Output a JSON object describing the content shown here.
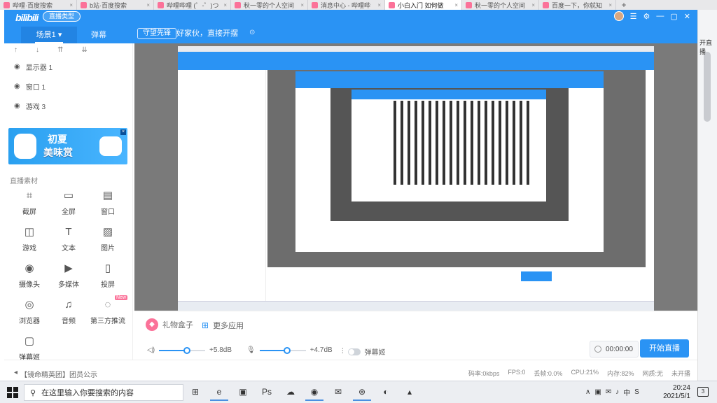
{
  "browser": {
    "tabs": [
      {
        "label": "哔哩·百度搜索",
        "active": false
      },
      {
        "label": "b站·百度搜索",
        "active": false
      },
      {
        "label": "哔哩哔哩 (゜-゜)つ",
        "active": false
      },
      {
        "label": "秋一零的个人空间",
        "active": false
      },
      {
        "label": "消息中心 - 哔哩哔",
        "active": false
      },
      {
        "label": "小白入门 如何做",
        "active": true
      },
      {
        "label": "秋一零的个人空间",
        "active": false
      },
      {
        "label": "百度一下，你就知",
        "active": false
      }
    ],
    "new_tab": "+",
    "page_edge_text": "开直播"
  },
  "header": {
    "logo": "bilibili",
    "room_type": "直播类型",
    "scene_tab": "场景1",
    "danmu_tab": "弹幕",
    "guard_button": "守望先锋",
    "hint": "好家伙，直接开摆",
    "hint_icon": "⊙",
    "icons": [
      "☰",
      "⚙",
      "—",
      "▢",
      "✕"
    ]
  },
  "sources": {
    "order_icons": [
      "↑",
      "↓",
      "⇈",
      "⇊"
    ],
    "items": [
      {
        "label": "显示器 1"
      },
      {
        "label": "窗口 1"
      },
      {
        "label": "游戏 3"
      }
    ]
  },
  "banner": {
    "line1": "初夏",
    "line2": "美味赏",
    "close": "×"
  },
  "materials": {
    "title": "直播素材",
    "items": [
      {
        "label": "截屏",
        "icon": "⌗"
      },
      {
        "label": "全屏",
        "icon": "▭"
      },
      {
        "label": "窗口",
        "icon": "▤"
      },
      {
        "label": "游戏",
        "icon": "◫"
      },
      {
        "label": "文本",
        "icon": "T"
      },
      {
        "label": "图片",
        "icon": "▨"
      },
      {
        "label": "摄像头",
        "icon": "◉"
      },
      {
        "label": "多媒体",
        "icon": "▶"
      },
      {
        "label": "投屏",
        "icon": "▯"
      },
      {
        "label": "浏览器",
        "icon": "◎"
      },
      {
        "label": "音频",
        "icon": "♫"
      },
      {
        "label": "第三方推流",
        "icon": "◌",
        "badge": "New"
      },
      {
        "label": "弹幕姬",
        "icon": "▢"
      }
    ]
  },
  "controls": {
    "gift_label": "礼物盒子",
    "more_apps_label": "更多应用",
    "speaker_volume": "+5.8dB",
    "speaker_level": 0.6,
    "mic_volume": "+4.7dB",
    "mic_level": 0.6,
    "danmu_toggle": "弹幕姬",
    "timer": "00:00:00",
    "start_button": "开始直播"
  },
  "status": {
    "notice": "【镜命精英团】团员公示",
    "bitrate": "码率:0kbps",
    "fps": "FPS:0",
    "dropped": "丢帧:0.0%",
    "cpu": "CPU:21%",
    "memory": "内存:82%",
    "network": "网质:无",
    "stream": "未开播"
  },
  "taskbar": {
    "search_placeholder": "在这里输入你要搜索的内容",
    "apps": [
      "⊞",
      "e",
      "▣",
      "Ps",
      "☁",
      "◉",
      "✉",
      "⊛",
      "◐",
      "▴"
    ],
    "tray": [
      "∧",
      "▣",
      "✉",
      "♪",
      "中",
      "S"
    ],
    "time": "20:24",
    "date": "2021/5/1",
    "notif": "3"
  },
  "colors": {
    "accent": "#2a93f4",
    "pink": "#fb7299"
  }
}
